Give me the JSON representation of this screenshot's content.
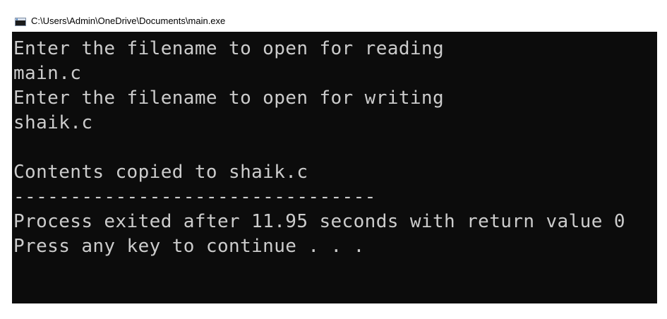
{
  "window": {
    "title": "C:\\Users\\Admin\\OneDrive\\Documents\\main.exe",
    "icon": "console-app-icon"
  },
  "console": {
    "lines": [
      "Enter the filename to open for reading",
      "main.c",
      "Enter the filename to open for writing",
      "shaik.c",
      "",
      "Contents copied to shaik.c",
      "--------------------------------",
      "Process exited after 11.95 seconds with return value 0",
      "Press any key to continue . . ."
    ]
  },
  "colors": {
    "background": "#0c0c0c",
    "text": "#cccccc",
    "titlebar": "#ffffff"
  }
}
